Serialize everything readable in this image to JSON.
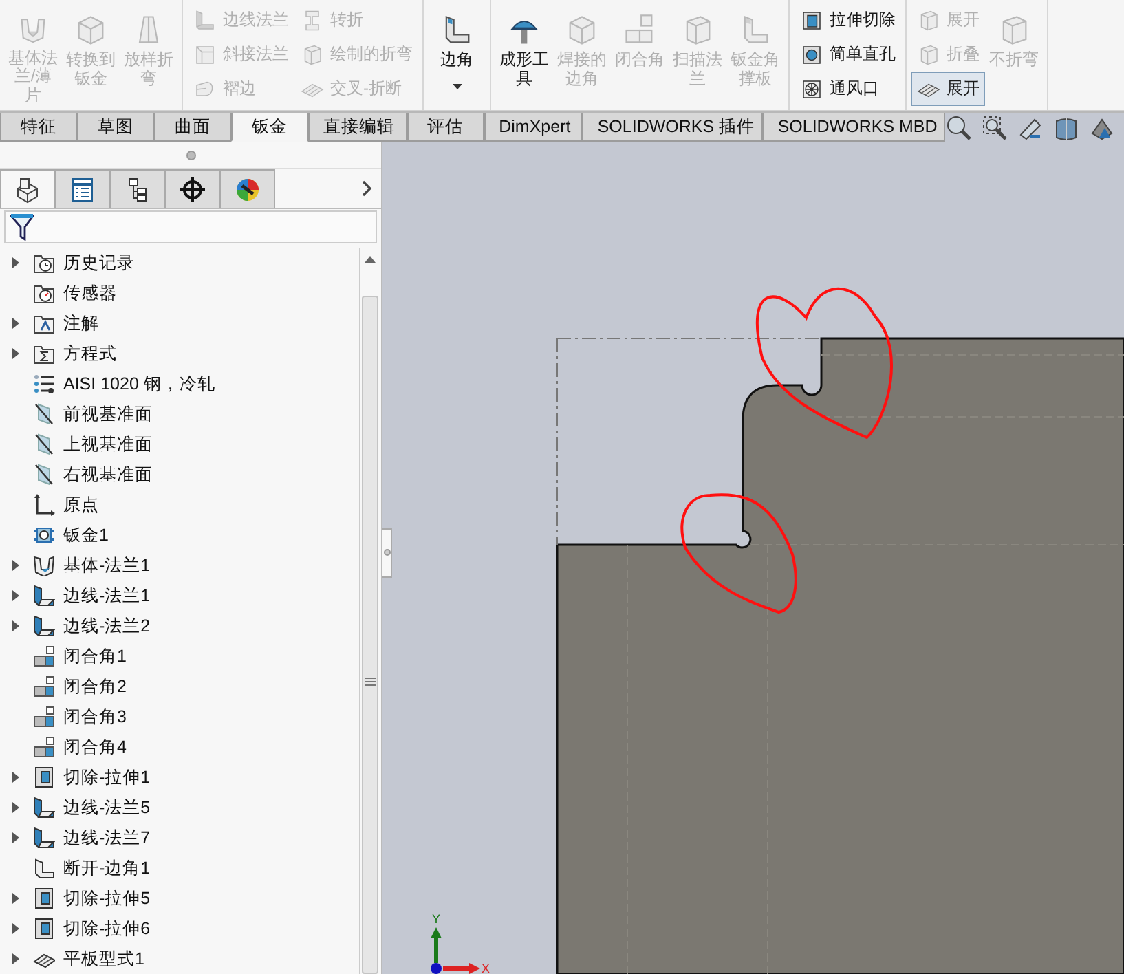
{
  "ribbon": {
    "groups": [
      {
        "columns": [
          {
            "items": [
              {
                "label": "基体法兰/薄片",
                "kind": "large",
                "disabled": true,
                "selected": false,
                "dropdown": false
              }
            ]
          },
          {
            "items": [
              {
                "label": "转换到钣金",
                "kind": "large",
                "disabled": true,
                "selected": false,
                "dropdown": false
              }
            ]
          },
          {
            "items": [
              {
                "label": "放样折弯",
                "kind": "large",
                "disabled": true,
                "selected": false,
                "dropdown": false
              }
            ]
          }
        ]
      },
      {
        "columns": [
          {
            "items": [
              {
                "label": "边线法兰",
                "kind": "small",
                "disabled": true,
                "selected": false,
                "dropdown": false
              },
              {
                "label": "斜接法兰",
                "kind": "small",
                "disabled": true,
                "selected": false,
                "dropdown": false
              },
              {
                "label": "褶边",
                "kind": "small",
                "disabled": true,
                "selected": false,
                "dropdown": false
              }
            ]
          },
          {
            "items": [
              {
                "label": "转折",
                "kind": "small",
                "disabled": true,
                "selected": false,
                "dropdown": false
              },
              {
                "label": "绘制的折弯",
                "kind": "small",
                "disabled": true,
                "selected": false,
                "dropdown": false
              },
              {
                "label": "交叉-折断",
                "kind": "small",
                "disabled": true,
                "selected": false,
                "dropdown": false
              }
            ]
          }
        ]
      },
      {
        "columns": [
          {
            "items": [
              {
                "label": "边角",
                "kind": "large",
                "disabled": false,
                "selected": false,
                "dropdown": true
              }
            ]
          }
        ]
      },
      {
        "columns": [
          {
            "items": [
              {
                "label": "成形工具",
                "kind": "large",
                "disabled": false,
                "selected": false,
                "dropdown": false
              }
            ]
          },
          {
            "items": [
              {
                "label": "焊接的边角",
                "kind": "large",
                "disabled": true,
                "selected": false,
                "dropdown": false
              }
            ]
          },
          {
            "items": [
              {
                "label": "闭合角",
                "kind": "large",
                "disabled": true,
                "selected": false,
                "dropdown": false
              }
            ]
          },
          {
            "items": [
              {
                "label": "扫描法兰",
                "kind": "large",
                "disabled": true,
                "selected": false,
                "dropdown": false
              }
            ]
          },
          {
            "items": [
              {
                "label": "钣金角撑板",
                "kind": "large",
                "disabled": true,
                "selected": false,
                "dropdown": false
              }
            ]
          }
        ]
      },
      {
        "columns": [
          {
            "items": [
              {
                "label": "拉伸切除",
                "kind": "small",
                "disabled": false,
                "selected": false,
                "dropdown": false
              },
              {
                "label": "简单直孔",
                "kind": "small",
                "disabled": false,
                "selected": false,
                "dropdown": false
              },
              {
                "label": "通风口",
                "kind": "small",
                "disabled": false,
                "selected": false,
                "dropdown": false
              }
            ]
          }
        ]
      },
      {
        "columns": [
          {
            "items": [
              {
                "label": "展开",
                "kind": "small",
                "disabled": true,
                "selected": false,
                "dropdown": false
              },
              {
                "label": "折叠",
                "kind": "small",
                "disabled": true,
                "selected": false,
                "dropdown": false
              },
              {
                "label": "展开",
                "kind": "small",
                "disabled": false,
                "selected": true,
                "dropdown": false
              }
            ]
          },
          {
            "items": [
              {
                "label": "不折弯",
                "kind": "large",
                "disabled": true,
                "selected": false,
                "dropdown": false
              }
            ]
          }
        ]
      }
    ]
  },
  "tabs": [
    {
      "label": "特征",
      "selected": false
    },
    {
      "label": "草图",
      "selected": false
    },
    {
      "label": "曲面",
      "selected": false
    },
    {
      "label": "钣金",
      "selected": true
    },
    {
      "label": "直接编辑",
      "selected": false
    },
    {
      "label": "评估",
      "selected": false
    },
    {
      "label": "DimXpert",
      "selected": false
    },
    {
      "label": "SOLIDWORKS 插件",
      "selected": false
    },
    {
      "label": "SOLIDWORKS MBD",
      "selected": false
    }
  ],
  "panel_tabs": [
    {
      "selected": true
    },
    {
      "selected": false
    },
    {
      "selected": false
    },
    {
      "selected": false
    },
    {
      "selected": false
    }
  ],
  "tree": {
    "items": [
      {
        "label": "历史记录",
        "expandable": true
      },
      {
        "label": "传感器",
        "expandable": false
      },
      {
        "label": "注解",
        "expandable": true
      },
      {
        "label": "方程式",
        "expandable": true
      },
      {
        "label": "AISI 1020 钢，冷轧",
        "expandable": false
      },
      {
        "label": "前视基准面",
        "expandable": false
      },
      {
        "label": "上视基准面",
        "expandable": false
      },
      {
        "label": "右视基准面",
        "expandable": false
      },
      {
        "label": "原点",
        "expandable": false
      },
      {
        "label": "钣金1",
        "expandable": false
      },
      {
        "label": "基体-法兰1",
        "expandable": true
      },
      {
        "label": "边线-法兰1",
        "expandable": true
      },
      {
        "label": "边线-法兰2",
        "expandable": true
      },
      {
        "label": "闭合角1",
        "expandable": false
      },
      {
        "label": "闭合角2",
        "expandable": false
      },
      {
        "label": "闭合角3",
        "expandable": false
      },
      {
        "label": "闭合角4",
        "expandable": false
      },
      {
        "label": "切除-拉伸1",
        "expandable": true
      },
      {
        "label": "边线-法兰5",
        "expandable": true
      },
      {
        "label": "边线-法兰7",
        "expandable": true
      },
      {
        "label": "断开-边角1",
        "expandable": false
      },
      {
        "label": "切除-拉伸5",
        "expandable": true
      },
      {
        "label": "切除-拉伸6",
        "expandable": true
      },
      {
        "label": "平板型式1",
        "expandable": true
      }
    ]
  },
  "viewport": {
    "triad": {
      "x": "X",
      "y": "Y"
    }
  }
}
